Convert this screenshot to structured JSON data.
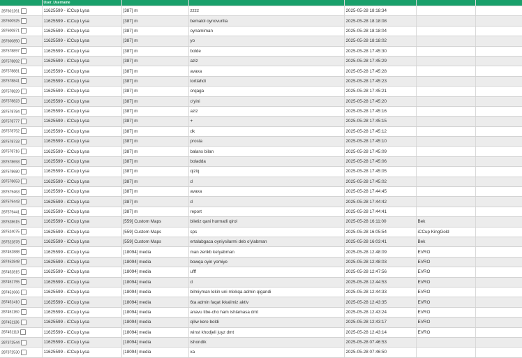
{
  "header": {
    "col2_label": "User_Username"
  },
  "rows": [
    {
      "id": "287601261",
      "user": "11625599 - iCCup Lysa",
      "channel": "[387] m",
      "message": "zzzz",
      "time": "2025-05-28 18:18:34",
      "extra": ""
    },
    {
      "id": "287600925",
      "user": "11625599 - iCCup Lysa",
      "channel": "[387] m",
      "message": "bemalol oynovurilia",
      "time": "2025-05-28 18:18:08",
      "extra": ""
    },
    {
      "id": "287600871",
      "user": "11625599 - iCCup Lysa",
      "channel": "[387] m",
      "message": "oynamiman",
      "time": "2025-05-28 18:18:04",
      "extra": ""
    },
    {
      "id": "287600850",
      "user": "11625599 - iCCup Lysa",
      "channel": "[387] m",
      "message": "yo",
      "time": "2025-05-28 18:18:02",
      "extra": ""
    },
    {
      "id": "287578897",
      "user": "11625599 - iCCup Lysa",
      "channel": "[387] m",
      "message": "bolde",
      "time": "2025-05-28 17:45:30",
      "extra": ""
    },
    {
      "id": "287578892",
      "user": "11625599 - iCCup Lysa",
      "channel": "[387] m",
      "message": "aziz",
      "time": "2025-05-28 17:45:29",
      "extra": ""
    },
    {
      "id": "287578881",
      "user": "11625599 - iCCup Lysa",
      "channel": "[387] m",
      "message": "avaxa",
      "time": "2025-05-28 17:45:28",
      "extra": ""
    },
    {
      "id": "287578841",
      "user": "11625599 - iCCup Lysa",
      "channel": "[387] m",
      "message": "tortlahdi",
      "time": "2025-05-28 17:45:23",
      "extra": ""
    },
    {
      "id": "287578829",
      "user": "11625599 - iCCup Lysa",
      "channel": "[387] m",
      "message": "orqaga",
      "time": "2025-05-28 17:45:21",
      "extra": ""
    },
    {
      "id": "287578823",
      "user": "11625599 - iCCup Lysa",
      "channel": "[387] m",
      "message": "o'yini",
      "time": "2025-05-28 17:45:20",
      "extra": ""
    },
    {
      "id": "287578784",
      "user": "11625599 - iCCup Lysa",
      "channel": "[387] m",
      "message": "aziz",
      "time": "2025-05-28 17:45:16",
      "extra": ""
    },
    {
      "id": "287578777",
      "user": "11625599 - iCCup Lysa",
      "channel": "[387] m",
      "message": "+",
      "time": "2025-05-28 17:45:15",
      "extra": ""
    },
    {
      "id": "287578752",
      "user": "11625599 - iCCup Lysa",
      "channel": "[387] m",
      "message": "dk",
      "time": "2025-05-28 17:45:12",
      "extra": ""
    },
    {
      "id": "287578733",
      "user": "11625599 - iCCup Lysa",
      "channel": "[387] m",
      "message": "prosta",
      "time": "2025-05-28 17:45:10",
      "extra": ""
    },
    {
      "id": "287578716",
      "user": "11625599 - iCCup Lysa",
      "channel": "[387] m",
      "message": "balans bilan",
      "time": "2025-05-28 17:45:09",
      "extra": ""
    },
    {
      "id": "287578693",
      "user": "11625599 - iCCup Lysa",
      "channel": "[387] m",
      "message": "boladda",
      "time": "2025-05-28 17:45:06",
      "extra": ""
    },
    {
      "id": "287578680",
      "user": "11625599 - iCCup Lysa",
      "channel": "[387] m",
      "message": "qiziq",
      "time": "2025-05-28 17:45:05",
      "extra": ""
    },
    {
      "id": "287578653",
      "user": "11625599 - iCCup Lysa",
      "channel": "[387] m",
      "message": "d",
      "time": "2025-05-28 17:45:02",
      "extra": ""
    },
    {
      "id": "287579463",
      "user": "11625599 - iCCup Lysa",
      "channel": "[387] m",
      "message": "avaxa",
      "time": "2025-05-28 17:44:45",
      "extra": ""
    },
    {
      "id": "287579443",
      "user": "11625599 - iCCup Lysa",
      "channel": "[387] m",
      "message": "d",
      "time": "2025-05-28 17:44:42",
      "extra": ""
    },
    {
      "id": "287579441",
      "user": "11625599 - iCCup Lysa",
      "channel": "[387] m",
      "message": "report",
      "time": "2025-05-28 17:44:41",
      "extra": ""
    },
    {
      "id": "287528615",
      "user": "11625599 - iCCup Lysa",
      "channel": "[559] Custom Maps",
      "message": "biletiz qani hurmatli qirol",
      "time": "2025-05-28 16:11:00",
      "extra": "Bek"
    },
    {
      "id": "287524075",
      "user": "11625599 - iCCup Lysa",
      "channel": "[559] Custom Maps",
      "message": "sps",
      "time": "2025-05-28 16:05:54",
      "extra": "iCCup KingGold"
    },
    {
      "id": "287522878",
      "user": "11625599 - iCCup Lysa",
      "channel": "[559] Custom Maps",
      "message": "ertalabgaca oyniysilarmi deb o'ylabman",
      "time": "2025-05-28 16:03:41",
      "extra": "Bek"
    },
    {
      "id": "287452888",
      "user": "11625599 - iCCup Lysa",
      "channel": "[18094] media",
      "message": "man zerikb ketyabman",
      "time": "2025-05-28 12:48:09",
      "extra": "EVRO"
    },
    {
      "id": "287452848",
      "user": "11625599 - iCCup Lysa",
      "channel": "[18094] media",
      "message": "bowqa oyin yomiye",
      "time": "2025-05-28 12:48:03",
      "extra": "EVRO"
    },
    {
      "id": "287452815",
      "user": "11625599 - iCCup Lysa",
      "channel": "[18094] media",
      "message": "ufff",
      "time": "2025-05-28 12:47:56",
      "extra": "EVRO"
    },
    {
      "id": "287451755",
      "user": "11625599 - iCCup Lysa",
      "channel": "[18094] media",
      "message": "d",
      "time": "2025-05-28 12:44:53",
      "extra": "EVRO"
    },
    {
      "id": "287451666",
      "user": "11625599 - iCCup Lysa",
      "channel": "[18094] media",
      "message": "bilmiyman lekin uni mixkqa admin qigandi",
      "time": "2025-05-28 12:44:33",
      "extra": "EVRO"
    },
    {
      "id": "287451410",
      "user": "11625599 - iCCup Lysa",
      "channel": "[18094] media",
      "message": "6ta admin faqat ikkalimiz aktiv",
      "time": "2025-05-28 12:43:35",
      "extra": "EVRO"
    },
    {
      "id": "287451160",
      "user": "11625599 - iCCup Lysa",
      "channel": "[18094] media",
      "message": "anavu tibe-cho ham ishlamasa dmt",
      "time": "2025-05-28 12:43:24",
      "extra": "EVRO"
    },
    {
      "id": "287451136",
      "user": "11625599 - iCCup Lysa",
      "channel": "[18094] media",
      "message": "qiliw kere boldi",
      "time": "2025-05-28 12:43:17",
      "extra": "EVRO"
    },
    {
      "id": "287451113",
      "user": "11625599 - iCCup Lysa",
      "channel": "[18094] media",
      "message": "winst khodjeli juyz dmt",
      "time": "2025-05-28 12:43:14",
      "extra": "EVRO"
    },
    {
      "id": "287372544",
      "user": "11625599 - iCCup Lysa",
      "channel": "[18094] media",
      "message": "ishondik",
      "time": "2025-05-28 07:46:53",
      "extra": ""
    },
    {
      "id": "287372530",
      "user": "11625599 - iCCup Lysa",
      "channel": "[18094] media",
      "message": "xa",
      "time": "2025-05-28 07:46:50",
      "extra": ""
    }
  ]
}
